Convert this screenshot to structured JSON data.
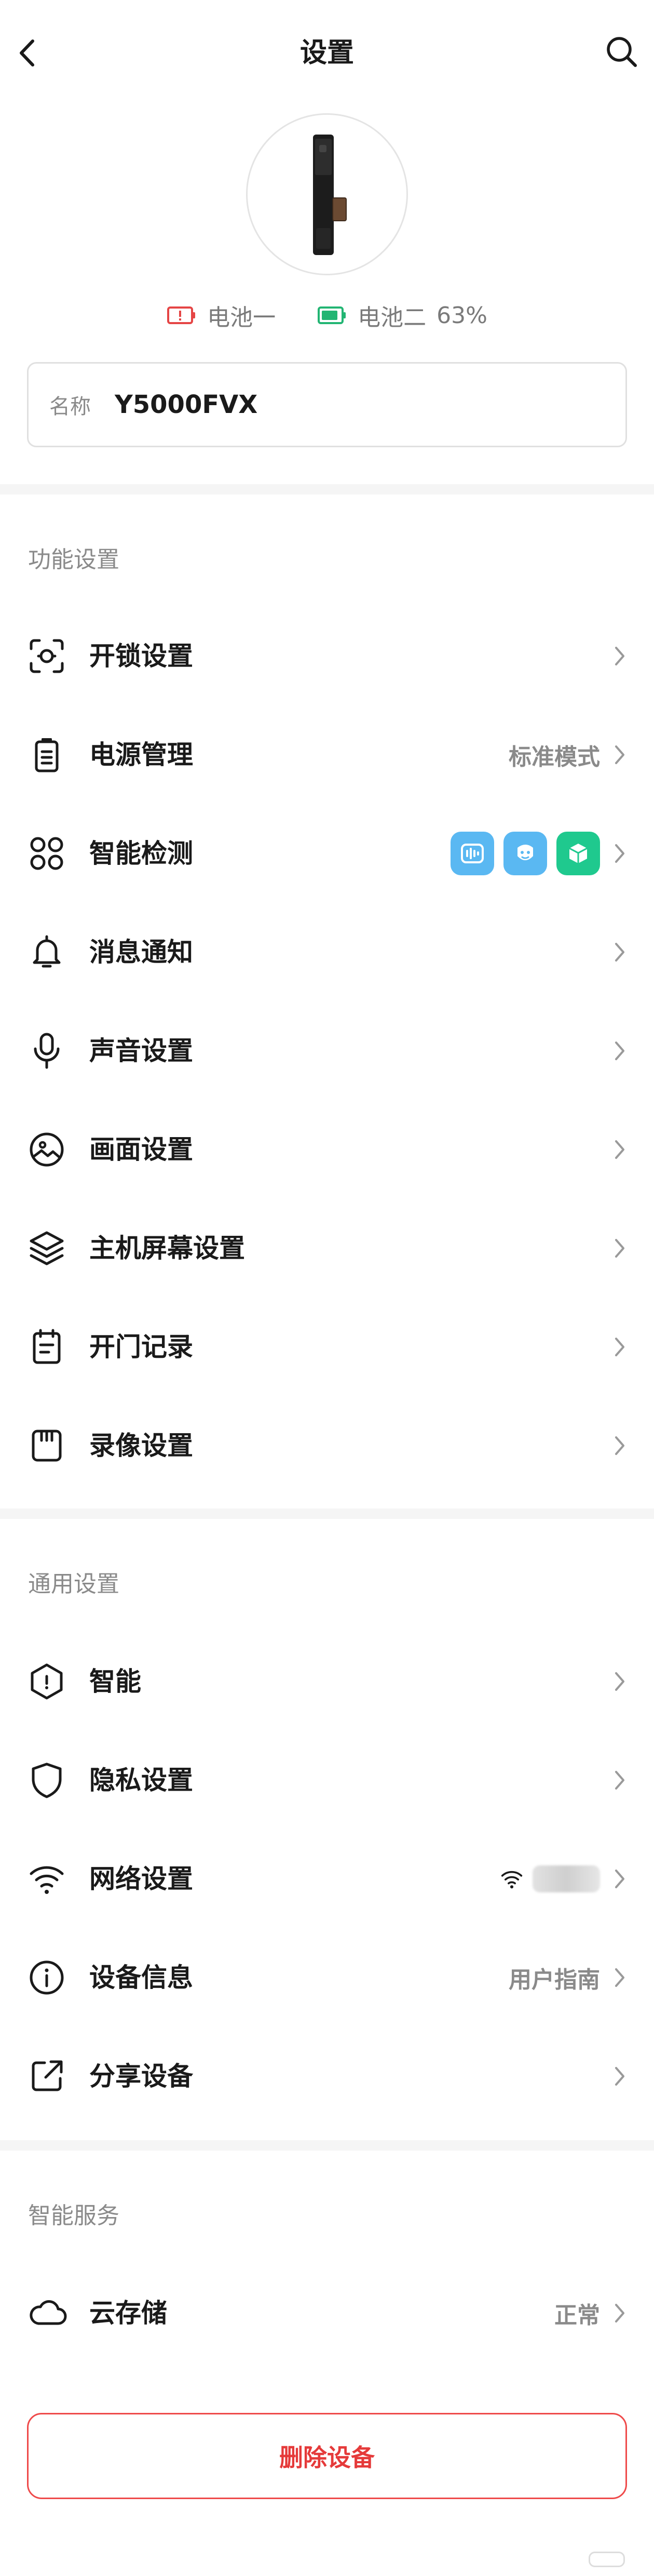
{
  "header": {
    "title": "设置"
  },
  "battery": [
    {
      "label": "电池一",
      "level": "",
      "status_color": "#e54545"
    },
    {
      "label": "电池二",
      "level": "63%",
      "status_color": "#22b573"
    }
  ],
  "name_field": {
    "label": "名称",
    "value": "Y5000FVX"
  },
  "sections": {
    "function": {
      "title": "功能设置",
      "items": [
        {
          "label": "开锁设置",
          "value": ""
        },
        {
          "label": "电源管理",
          "value": "标准模式"
        },
        {
          "label": "智能检测",
          "value": ""
        },
        {
          "label": "消息通知",
          "value": ""
        },
        {
          "label": "声音设置",
          "value": ""
        },
        {
          "label": "画面设置",
          "value": ""
        },
        {
          "label": "主机屏幕设置",
          "value": ""
        },
        {
          "label": "开门记录",
          "value": ""
        },
        {
          "label": "录像设置",
          "value": ""
        }
      ]
    },
    "general": {
      "title": "通用设置",
      "items": [
        {
          "label": "智能",
          "value": ""
        },
        {
          "label": "隐私设置",
          "value": ""
        },
        {
          "label": "网络设置",
          "value": ""
        },
        {
          "label": "设备信息",
          "value": "用户指南"
        },
        {
          "label": "分享设备",
          "value": ""
        }
      ]
    },
    "service": {
      "title": "智能服务",
      "items": [
        {
          "label": "云存储",
          "value": "正常"
        }
      ]
    }
  },
  "delete_button": {
    "label": "删除设备"
  },
  "colors": {
    "accent_red": "#e53a3a",
    "badge_blue": "#5ab8f2",
    "badge_teal": "#1fc98e"
  }
}
